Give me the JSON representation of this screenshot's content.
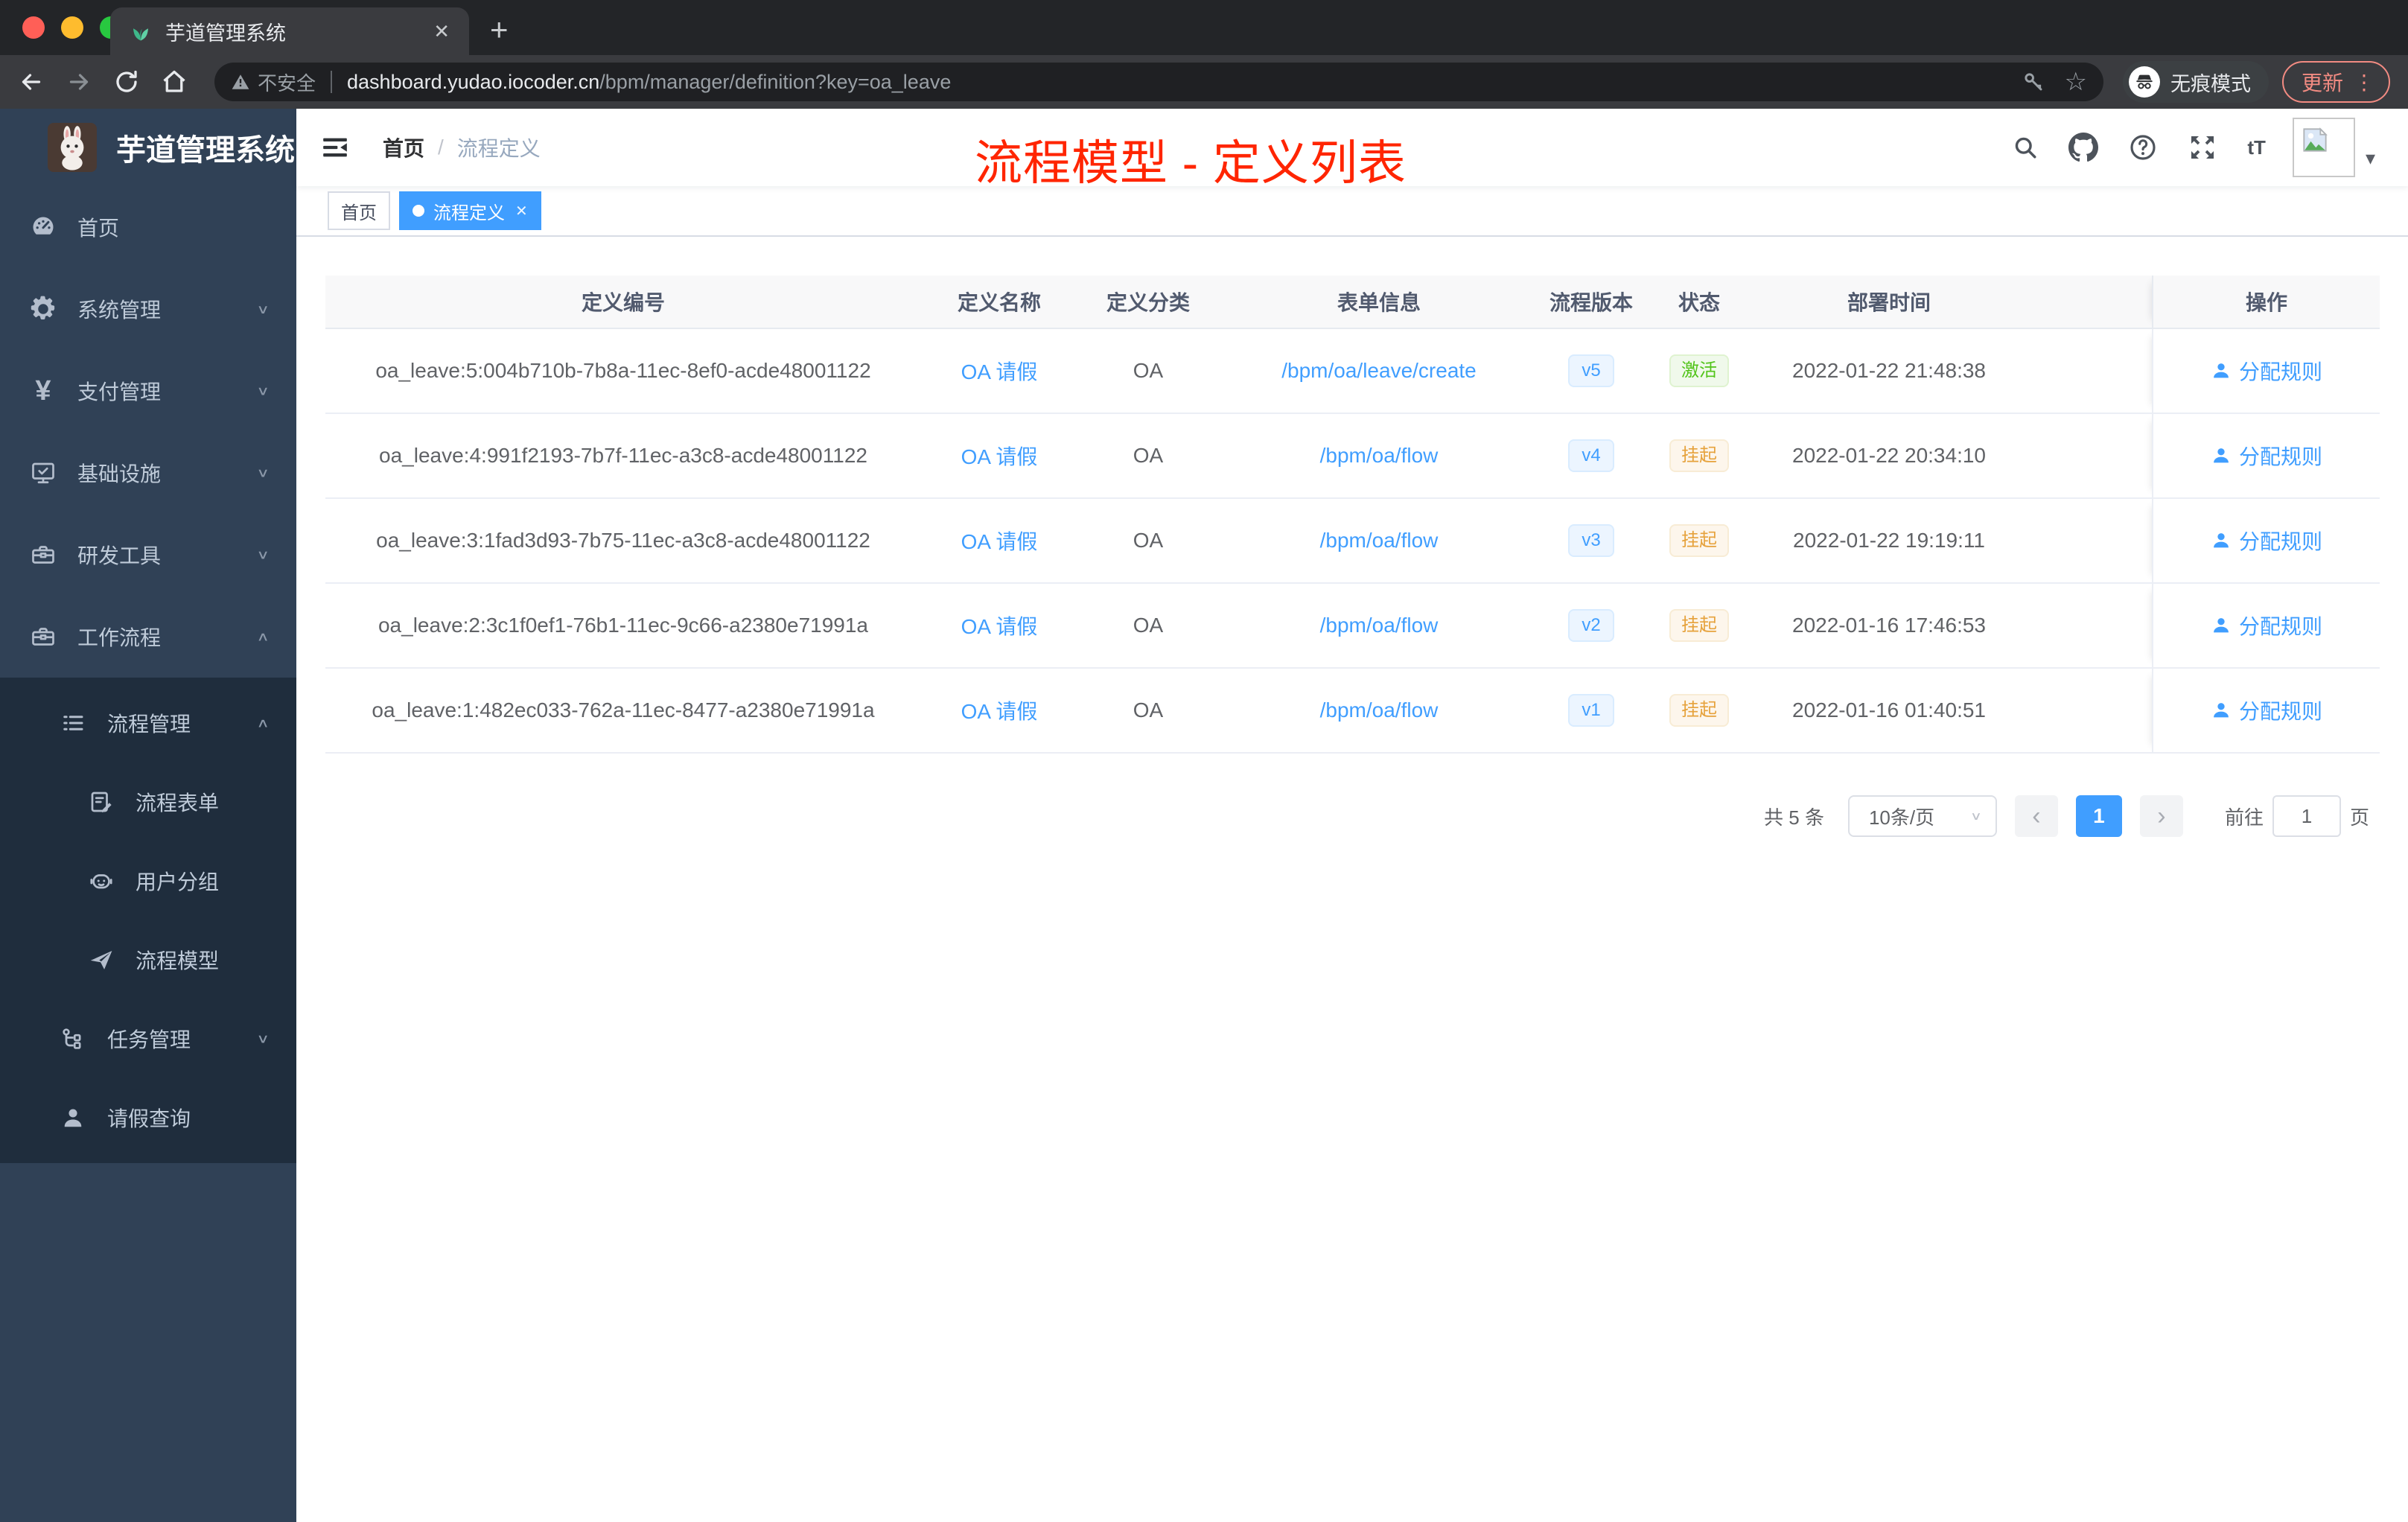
{
  "browser": {
    "tab_title": "芋道管理系统",
    "security_label": "不安全",
    "url_host": "dashboard.yudao.iocoder.cn",
    "url_path": "/bpm/manager/definition?key=oa_leave",
    "incognito_label": "无痕模式",
    "update_label": "更新"
  },
  "icons": {
    "close": "✕",
    "plus": "+",
    "star": "☆",
    "more_vertical": "⋮",
    "caret_down": "▾",
    "chevron_down": "∨",
    "chevron_up": "∧",
    "select_arrow": "∨",
    "page_prev": "‹",
    "page_next": "›",
    "text_size": "tT",
    "yen": "¥"
  },
  "sidebar": {
    "app_title": "芋道管理系统",
    "menu": [
      {
        "label": "首页"
      },
      {
        "label": "系统管理"
      },
      {
        "label": "支付管理"
      },
      {
        "label": "基础设施"
      },
      {
        "label": "研发工具"
      },
      {
        "label": "工作流程"
      },
      {
        "label": "流程管理"
      },
      {
        "label": "流程表单"
      },
      {
        "label": "用户分组"
      },
      {
        "label": "流程模型"
      },
      {
        "label": "任务管理"
      },
      {
        "label": "请假查询"
      }
    ]
  },
  "navbar": {
    "breadcrumb_home": "首页",
    "breadcrumb_separator": "/",
    "breadcrumb_current": "流程定义"
  },
  "tags_view": {
    "home": "首页",
    "active": "流程定义"
  },
  "annotation": {
    "text": "流程模型 - 定义列表",
    "color": "#ff2500"
  },
  "table": {
    "columns": {
      "id": "定义编号",
      "name": "定义名称",
      "category": "定义分类",
      "form": "表单信息",
      "version": "流程版本",
      "status": "状态",
      "deploy_time": "部署时间",
      "actions": "操作"
    },
    "rows": [
      {
        "id": "oa_leave:5:004b710b-7b8a-11ec-8ef0-acde48001122",
        "name": "OA 请假",
        "category": "OA",
        "form": "/bpm/oa/leave/create",
        "version": "v5",
        "status": "激活",
        "deploy_time": "2022-01-22 21:48:38",
        "action": "分配规则"
      },
      {
        "id": "oa_leave:4:991f2193-7b7f-11ec-a3c8-acde48001122",
        "name": "OA 请假",
        "category": "OA",
        "form": "/bpm/oa/flow",
        "version": "v4",
        "status": "挂起",
        "deploy_time": "2022-01-22 20:34:10",
        "action": "分配规则"
      },
      {
        "id": "oa_leave:3:1fad3d93-7b75-11ec-a3c8-acde48001122",
        "name": "OA 请假",
        "category": "OA",
        "form": "/bpm/oa/flow",
        "version": "v3",
        "status": "挂起",
        "deploy_time": "2022-01-22 19:19:11",
        "action": "分配规则"
      },
      {
        "id": "oa_leave:2:3c1f0ef1-76b1-11ec-9c66-a2380e71991a",
        "name": "OA 请假",
        "category": "OA",
        "form": "/bpm/oa/flow",
        "version": "v2",
        "status": "挂起",
        "deploy_time": "2022-01-16 17:46:53",
        "action": "分配规则"
      },
      {
        "id": "oa_leave:1:482ec033-762a-11ec-8477-a2380e71991a",
        "name": "OA 请假",
        "category": "OA",
        "form": "/bpm/oa/flow",
        "version": "v1",
        "status": "挂起",
        "deploy_time": "2022-01-16 01:40:51",
        "action": "分配规则"
      }
    ]
  },
  "pagination": {
    "total": "共 5 条",
    "page_size": "10条/页",
    "current_page": "1",
    "goto_label": "前往",
    "goto_value": "1",
    "page_unit": "页"
  },
  "colors": {
    "accent": "#409eff",
    "success": "#67c23a",
    "warning": "#e6a23c",
    "sidebar_bg": "#304156",
    "submenu_bg": "#1f2d3d",
    "annotation_red": "#ff2500"
  }
}
